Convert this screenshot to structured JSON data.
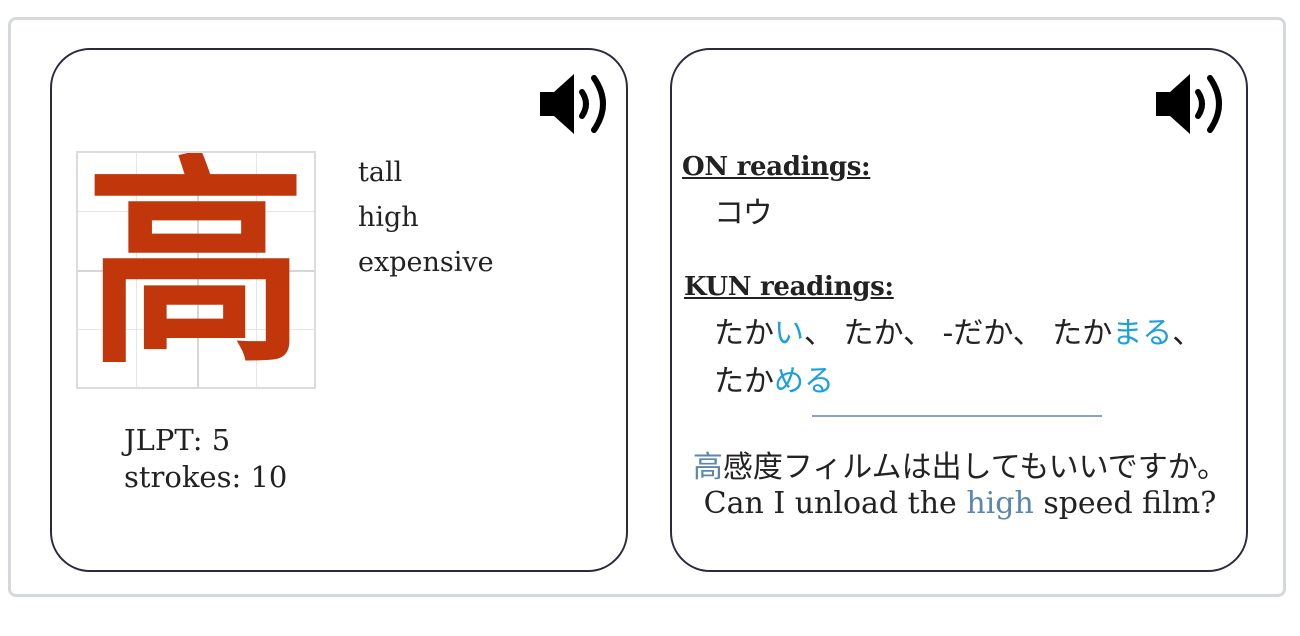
{
  "front": {
    "kanji": "高",
    "meanings": [
      "tall",
      "high",
      "expensive"
    ],
    "jlpt_label": "JLPT: 5",
    "strokes_label": "strokes: 10",
    "audio_icon": "speaker-icon",
    "kanji_color": "#c2360b"
  },
  "back": {
    "audio_icon": "speaker-icon",
    "on_title": "ON readings:",
    "on_readings": "コウ",
    "kun_title": "KUN readings:",
    "kun_line1": {
      "r1_stem": "たか",
      "r1_okuri": "い",
      "sep1": "、 ",
      "r2": "たか",
      "sep2": "、 ",
      "r3": "-だか",
      "sep3": "、 ",
      "r4_stem": "たか",
      "r4_okuri": "まる",
      "sep4": "、"
    },
    "kun_line2": {
      "r5_stem": "たか",
      "r5_okuri": "める"
    },
    "example": {
      "jp_highlight": "高",
      "jp_rest": "感度フィルムは出してもいいですか。",
      "en_before": "Can I unload the ",
      "en_highlight": "high",
      "en_after": " speed film?"
    },
    "okurigana_color": "#1e9fe0",
    "highlight_color": "#5b86ad"
  }
}
